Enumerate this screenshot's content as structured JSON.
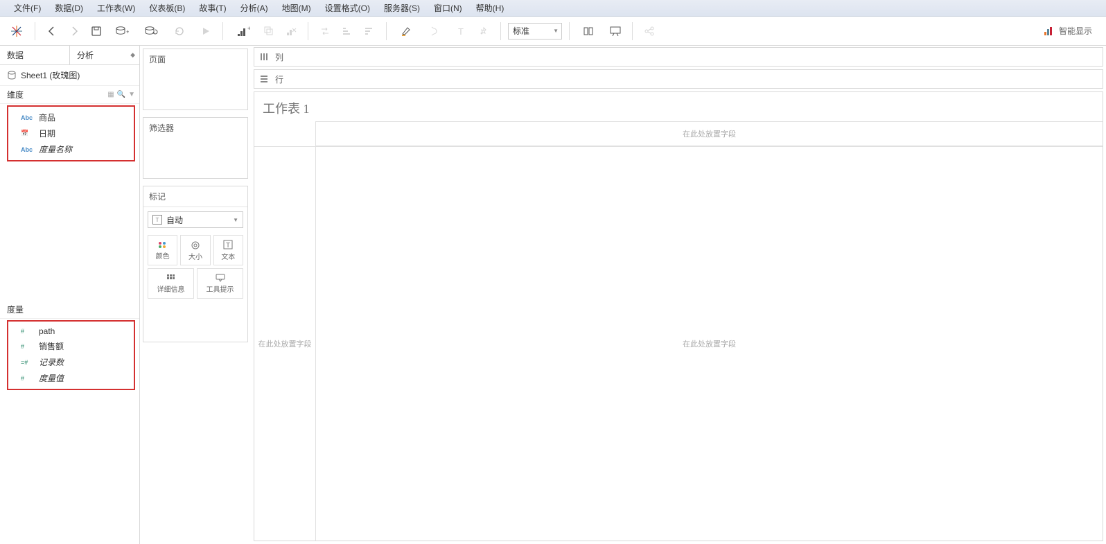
{
  "menu": {
    "file": "文件(F)",
    "data": "数据(D)",
    "worksheet": "工作表(W)",
    "dashboard": "仪表板(B)",
    "story": "故事(T)",
    "analysis": "分析(A)",
    "map": "地图(M)",
    "format": "设置格式(O)",
    "server": "服务器(S)",
    "window": "窗口(N)",
    "help": "帮助(H)"
  },
  "toolbar": {
    "fit": "标准",
    "showme": "智能显示"
  },
  "sidepane": {
    "tab_data": "数据",
    "tab_analytics": "分析",
    "datasource": "Sheet1 (玫瑰图)",
    "dimensions_label": "维度",
    "dimensions": {
      "product": "商品",
      "date": "日期",
      "measure_names": "度量名称"
    },
    "measures_label": "度量",
    "measures": {
      "path": "path",
      "sales": "销售额",
      "records": "记录数",
      "measure_values": "度量值"
    }
  },
  "cards": {
    "pages": "页面",
    "filters": "筛选器",
    "marks": "标记",
    "marks_type": "自动",
    "color": "颜色",
    "size": "大小",
    "text": "文本",
    "detail": "详细信息",
    "tooltip": "工具提示"
  },
  "shelves": {
    "columns": "列",
    "rows": "行"
  },
  "worksheet": {
    "title": "工作表 1",
    "drop_col": "在此处放置字段",
    "drop_row": "在此处放置字段",
    "drop_body": "在此处放置字段"
  }
}
